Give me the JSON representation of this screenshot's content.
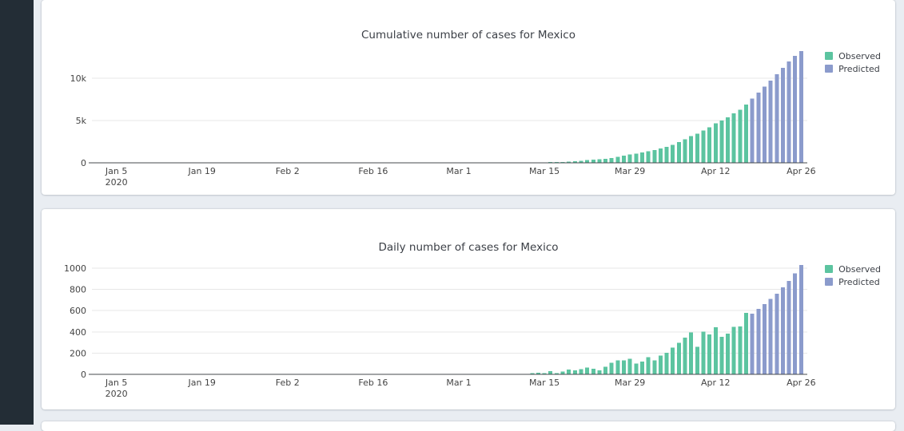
{
  "theme": {
    "page_background": "#e9edf2",
    "sidebar_color": "#232d36",
    "card_color": "#ffffff",
    "observed_color": "#5cc4a0",
    "predicted_color": "#8b9bcc",
    "axis_line_color": "#46484c",
    "gridline_color": "#e7e7e7"
  },
  "chart_data": [
    {
      "type": "bar",
      "title": "Cumulative number of cases for Mexico",
      "legend_position": "top-right-outside",
      "grid": "horizontal-only",
      "legend": [
        {
          "name": "Observed",
          "color": "#5cc4a0"
        },
        {
          "name": "Predicted",
          "color": "#8b9bcc"
        }
      ],
      "x_range": [
        "2020-01-01",
        "2020-04-27"
      ],
      "y_max": 13600,
      "y_ticks": [
        {
          "value": 0,
          "label": "0"
        },
        {
          "value": 5000,
          "label": "5k"
        },
        {
          "value": 10000,
          "label": "10k"
        }
      ],
      "x_ticks": [
        {
          "date": "2020-01-05",
          "label": "Jan 5",
          "sublabel": "2020"
        },
        {
          "date": "2020-01-19",
          "label": "Jan 19"
        },
        {
          "date": "2020-02-02",
          "label": "Feb 2"
        },
        {
          "date": "2020-02-16",
          "label": "Feb 16"
        },
        {
          "date": "2020-03-01",
          "label": "Mar 1"
        },
        {
          "date": "2020-03-15",
          "label": "Mar 15"
        },
        {
          "date": "2020-03-29",
          "label": "Mar 29"
        },
        {
          "date": "2020-04-12",
          "label": "Apr 12"
        },
        {
          "date": "2020-04-26",
          "label": "Apr 26"
        }
      ],
      "series": [
        {
          "name": "Observed",
          "color": "#5cc4a0",
          "dates": [
            "2020-02-28",
            "2020-02-29",
            "2020-03-01",
            "2020-03-02",
            "2020-03-03",
            "2020-03-04",
            "2020-03-05",
            "2020-03-06",
            "2020-03-07",
            "2020-03-08",
            "2020-03-09",
            "2020-03-10",
            "2020-03-11",
            "2020-03-12",
            "2020-03-13",
            "2020-03-14",
            "2020-03-15",
            "2020-03-16",
            "2020-03-17",
            "2020-03-18",
            "2020-03-19",
            "2020-03-20",
            "2020-03-21",
            "2020-03-22",
            "2020-03-23",
            "2020-03-24",
            "2020-03-25",
            "2020-03-26",
            "2020-03-27",
            "2020-03-28",
            "2020-03-29",
            "2020-03-30",
            "2020-03-31",
            "2020-04-01",
            "2020-04-02",
            "2020-04-03",
            "2020-04-04",
            "2020-04-05",
            "2020-04-06",
            "2020-04-07",
            "2020-04-08",
            "2020-04-09",
            "2020-04-10",
            "2020-04-11",
            "2020-04-12",
            "2020-04-13",
            "2020-04-14",
            "2020-04-15",
            "2020-04-16",
            "2020-04-17"
          ],
          "values": [
            3,
            4,
            5,
            5,
            5,
            5,
            5,
            6,
            6,
            7,
            7,
            7,
            11,
            15,
            26,
            41,
            53,
            82,
            93,
            118,
            164,
            203,
            251,
            316,
            367,
            405,
            475,
            585,
            717,
            848,
            993,
            1094,
            1215,
            1378,
            1510,
            1688,
            1890,
            2143,
            2439,
            2785,
            3181,
            3441,
            3844,
            4219,
            4661,
            5014,
            5399,
            5847,
            6297,
            6875
          ]
        },
        {
          "name": "Predicted",
          "color": "#8b9bcc",
          "dates": [
            "2020-04-18",
            "2020-04-19",
            "2020-04-20",
            "2020-04-21",
            "2020-04-22",
            "2020-04-23",
            "2020-04-24",
            "2020-04-25",
            "2020-04-26"
          ],
          "values": [
            7600,
            8300,
            9000,
            9750,
            10500,
            11250,
            12000,
            12650,
            13200
          ]
        }
      ]
    },
    {
      "type": "bar",
      "title": "Daily number of cases for Mexico",
      "legend_position": "top-right-outside",
      "grid": "horizontal-only",
      "legend": [
        {
          "name": "Observed",
          "color": "#5cc4a0"
        },
        {
          "name": "Predicted",
          "color": "#8b9bcc"
        }
      ],
      "x_range": [
        "2020-01-01",
        "2020-04-27"
      ],
      "y_max": 1060,
      "y_ticks": [
        {
          "value": 0,
          "label": "0"
        },
        {
          "value": 200,
          "label": "200"
        },
        {
          "value": 400,
          "label": "400"
        },
        {
          "value": 600,
          "label": "600"
        },
        {
          "value": 800,
          "label": "800"
        },
        {
          "value": 1000,
          "label": "1000"
        }
      ],
      "x_ticks": [
        {
          "date": "2020-01-05",
          "label": "Jan 5",
          "sublabel": "2020"
        },
        {
          "date": "2020-01-19",
          "label": "Jan 19"
        },
        {
          "date": "2020-02-02",
          "label": "Feb 2"
        },
        {
          "date": "2020-02-16",
          "label": "Feb 16"
        },
        {
          "date": "2020-03-01",
          "label": "Mar 1"
        },
        {
          "date": "2020-03-15",
          "label": "Mar 15"
        },
        {
          "date": "2020-03-29",
          "label": "Mar 29"
        },
        {
          "date": "2020-04-12",
          "label": "Apr 12"
        },
        {
          "date": "2020-04-26",
          "label": "Apr 26"
        }
      ],
      "series": [
        {
          "name": "Observed",
          "color": "#5cc4a0",
          "dates": [
            "2020-02-28",
            "2020-02-29",
            "2020-03-01",
            "2020-03-02",
            "2020-03-03",
            "2020-03-04",
            "2020-03-05",
            "2020-03-06",
            "2020-03-07",
            "2020-03-08",
            "2020-03-09",
            "2020-03-10",
            "2020-03-11",
            "2020-03-12",
            "2020-03-13",
            "2020-03-14",
            "2020-03-15",
            "2020-03-16",
            "2020-03-17",
            "2020-03-18",
            "2020-03-19",
            "2020-03-20",
            "2020-03-21",
            "2020-03-22",
            "2020-03-23",
            "2020-03-24",
            "2020-03-25",
            "2020-03-26",
            "2020-03-27",
            "2020-03-28",
            "2020-03-29",
            "2020-03-30",
            "2020-03-31",
            "2020-04-01",
            "2020-04-02",
            "2020-04-03",
            "2020-04-04",
            "2020-04-05",
            "2020-04-06",
            "2020-04-07",
            "2020-04-08",
            "2020-04-09",
            "2020-04-10",
            "2020-04-11",
            "2020-04-12",
            "2020-04-13",
            "2020-04-14",
            "2020-04-15",
            "2020-04-16",
            "2020-04-17"
          ],
          "values": [
            3,
            1,
            1,
            0,
            0,
            0,
            0,
            1,
            0,
            1,
            0,
            0,
            4,
            4,
            11,
            15,
            12,
            29,
            11,
            25,
            46,
            39,
            48,
            65,
            51,
            38,
            70,
            110,
            132,
            131,
            145,
            101,
            121,
            163,
            132,
            178,
            202,
            253,
            296,
            346,
            396,
            260,
            403,
            375,
            442,
            353,
            385,
            448,
            450,
            578
          ]
        },
        {
          "name": "Predicted",
          "color": "#8b9bcc",
          "dates": [
            "2020-04-18",
            "2020-04-19",
            "2020-04-20",
            "2020-04-21",
            "2020-04-22",
            "2020-04-23",
            "2020-04-24",
            "2020-04-25",
            "2020-04-26"
          ],
          "values": [
            570,
            615,
            660,
            710,
            760,
            820,
            880,
            950,
            1030
          ]
        }
      ]
    }
  ]
}
